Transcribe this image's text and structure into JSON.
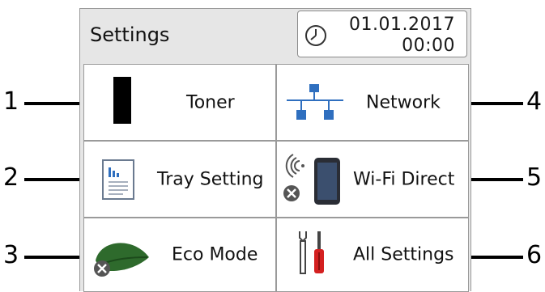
{
  "screen": {
    "title": "Settings",
    "date": "01.01.2017",
    "time": "00:00"
  },
  "tiles": [
    {
      "label": "Toner",
      "icon": "toner-cartridge-icon"
    },
    {
      "label": "Network",
      "icon": "network-icon"
    },
    {
      "label": "Tray Setting",
      "icon": "tray-setting-icon"
    },
    {
      "label": "Wi-Fi Direct",
      "icon": "wifi-direct-icon"
    },
    {
      "label": "Eco Mode",
      "icon": "eco-leaf-icon"
    },
    {
      "label": "All Settings",
      "icon": "tools-icon"
    }
  ],
  "callouts": [
    "1",
    "2",
    "3",
    "4",
    "5",
    "6"
  ],
  "colors": {
    "screen_bg": "#e6e6e6",
    "tile_bg": "#ffffff",
    "network_blue": "#2f6fbf",
    "leaf_green": "#2e6a2c",
    "tool_red": "#d42020"
  }
}
